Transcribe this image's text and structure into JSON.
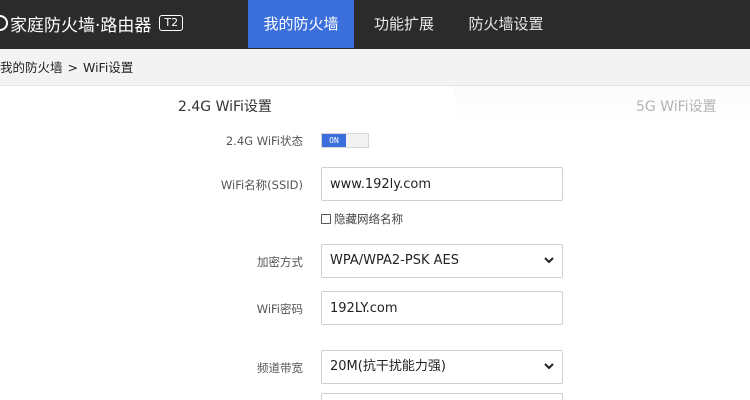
{
  "app": {
    "brand_title": "家庭防火墙·路由器",
    "brand_badge": "T2"
  },
  "nav": {
    "tabs": [
      {
        "label": "我的防火墙",
        "active": true
      },
      {
        "label": "功能扩展",
        "active": false
      },
      {
        "label": "防火墙设置",
        "active": false
      }
    ]
  },
  "breadcrumb": {
    "items": [
      "我的防火墙",
      ">",
      "WiFi设置"
    ]
  },
  "sections": {
    "active": "2.4G WiFi设置",
    "inactive": "5G WiFi设置"
  },
  "form": {
    "wifi_status": {
      "label": "2.4G WiFi状态",
      "toggle_text": "ON"
    },
    "ssid": {
      "label": "WiFi名称(SSID)",
      "value": "www.192ly.com"
    },
    "hide_network": {
      "label": "隐藏网络名称",
      "checked": false
    },
    "encryption": {
      "label": "加密方式",
      "value": "WPA/WPA2-PSK AES"
    },
    "password": {
      "label": "WiFi密码",
      "value": "192LY.com"
    },
    "bandwidth": {
      "label": "频道带宽",
      "value": "20M(抗干扰能力强)"
    }
  },
  "colors": {
    "accent": "#3b6fdc",
    "topbar": "#2b2b2b"
  }
}
